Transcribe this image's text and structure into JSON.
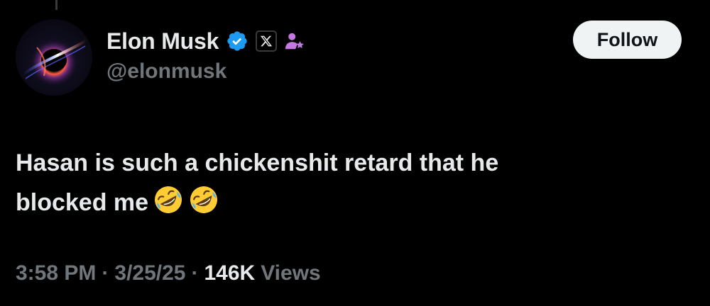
{
  "post": {
    "author": {
      "display_name": "Elon Musk",
      "handle": "@elonmusk",
      "badges": [
        "verified-badge-icon",
        "x-affiliate-icon",
        "pronoun-person-icon"
      ]
    },
    "follow_label": "Follow",
    "text_line_1": "Hasan is such a chickenshit retard that he",
    "text_line_2": "blocked me",
    "emoji": [
      "rofl-emoji",
      "rofl-emoji"
    ],
    "time": "3:58 PM",
    "separator": "·",
    "date": "3/25/25",
    "views_count": "146K",
    "views_label": "Views"
  },
  "colors": {
    "background": "#000000",
    "primary_text": "#e7e9ea",
    "secondary_text": "#71767b",
    "verified_blue": "#1d9bf0",
    "follow_bg": "#eff3f4",
    "person_badge": "#c479e0"
  }
}
